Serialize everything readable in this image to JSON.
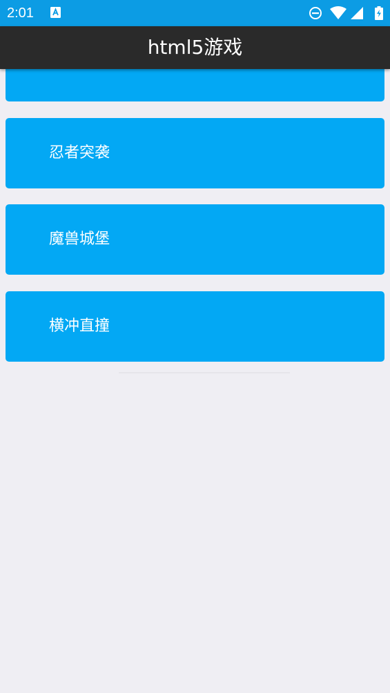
{
  "status_bar": {
    "time": "2:01",
    "icons": [
      "a-icon",
      "do-not-disturb-icon",
      "wifi-icon",
      "signal-icon",
      "battery-charging-icon"
    ],
    "background_color": "#0c9ce4"
  },
  "app_bar": {
    "title": "html5游戏",
    "background_color": "#2a2a2a"
  },
  "games": {
    "accent_color": "#03a8f4",
    "items": [
      {
        "label": ""
      },
      {
        "label": "忍者突袭"
      },
      {
        "label": "魔兽城堡"
      },
      {
        "label": "横冲直撞"
      }
    ]
  }
}
